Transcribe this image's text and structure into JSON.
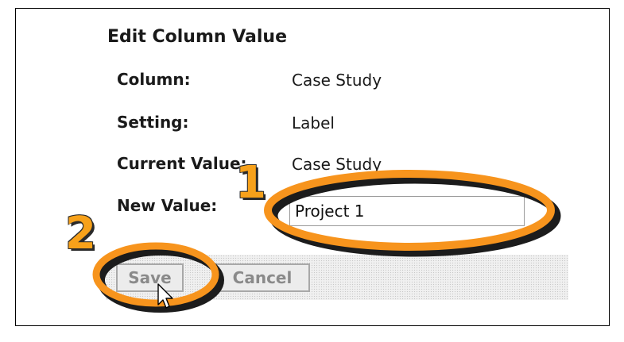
{
  "dialog": {
    "title": "Edit Column Value",
    "rows": [
      {
        "label": "Column:",
        "value": "Case Study"
      },
      {
        "label": "Setting:",
        "value": "Label"
      },
      {
        "label": "Current Value:",
        "value": "Case Study"
      }
    ],
    "new_value_label": "New Value:",
    "new_value": "Project 1",
    "save_label": "Save",
    "cancel_label": "Cancel"
  },
  "annotations": {
    "step_1": "1",
    "step_2": "2",
    "highlight_color": "#f7941d"
  }
}
